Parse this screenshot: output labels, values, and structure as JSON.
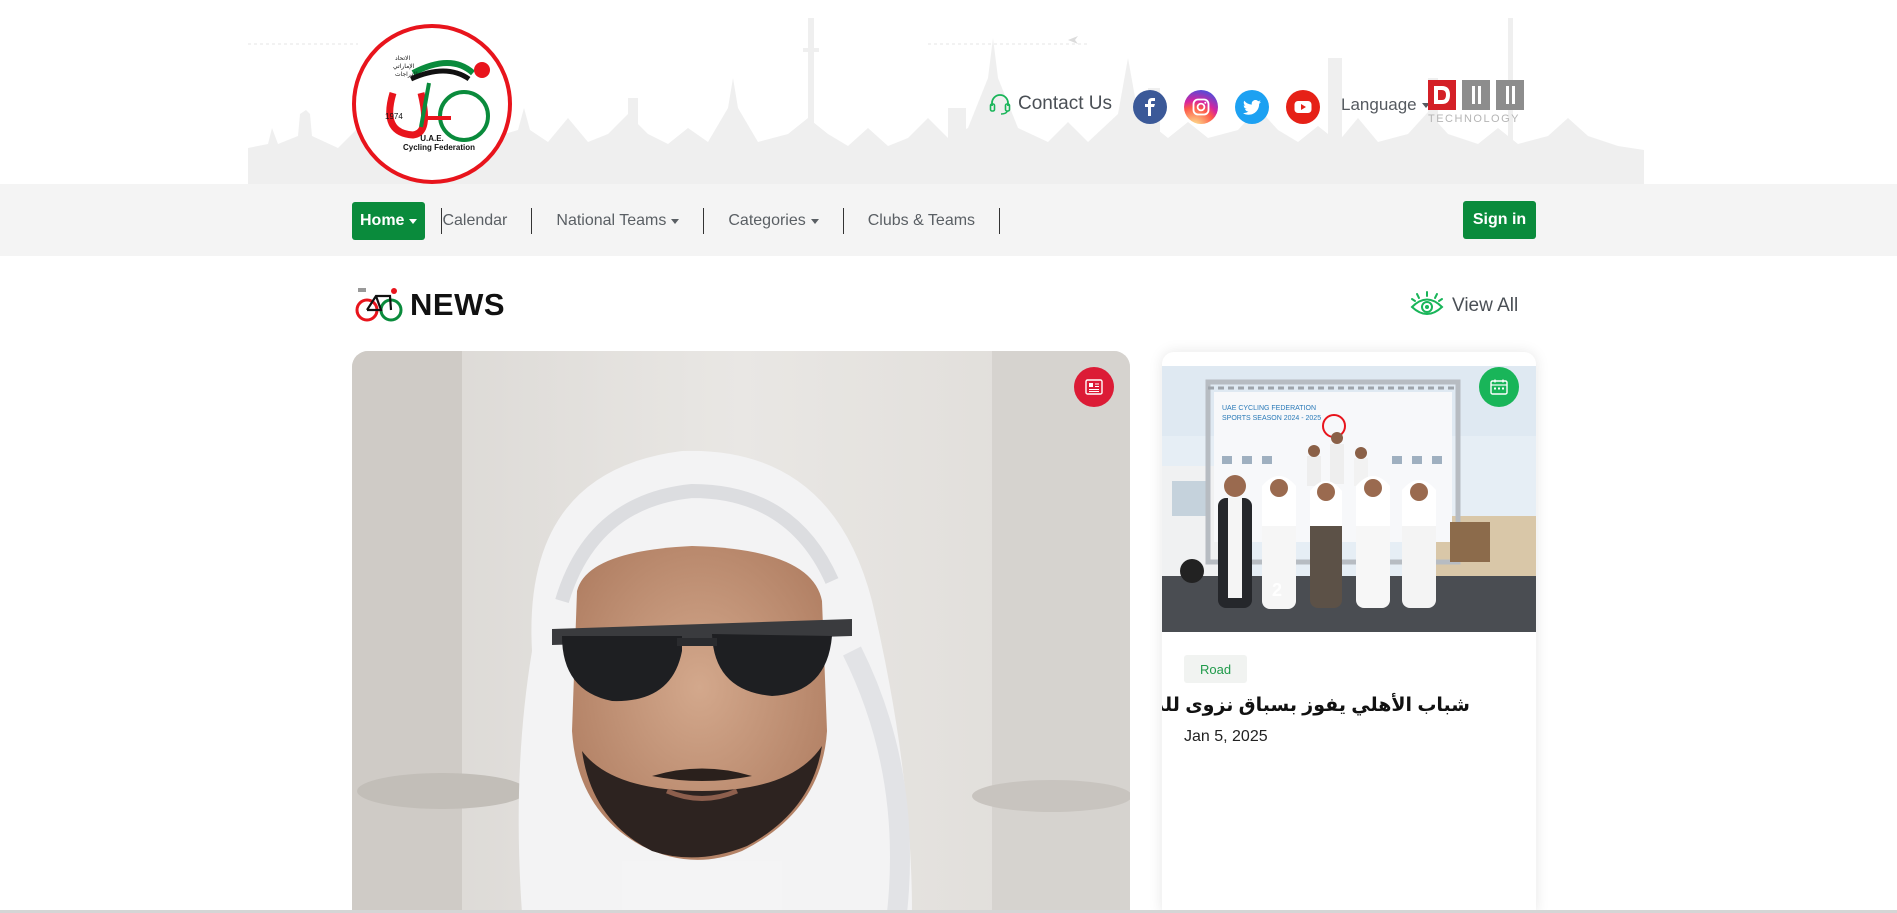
{
  "header": {
    "logo_lines": [
      "U.A.E.",
      "Cycling Federation"
    ],
    "logo_year": "1974",
    "logo_arabic": [
      "الاتحاد",
      "الإماراتي",
      "للدراجات"
    ],
    "contact_label": "Contact Us",
    "socials": [
      {
        "name": "facebook",
        "glyph": "f"
      },
      {
        "name": "instagram",
        "glyph": "◎"
      },
      {
        "name": "twitter",
        "glyph": "t"
      },
      {
        "name": "youtube",
        "glyph": "▶"
      }
    ],
    "language_label": "Language",
    "partner_logo_text": "TECHNOLOGY"
  },
  "nav": {
    "items": [
      {
        "label": "Home",
        "dropdown": true,
        "active": true
      },
      {
        "label": "Calendar",
        "dropdown": false
      },
      {
        "label": "National Teams",
        "dropdown": true
      },
      {
        "label": "Categories",
        "dropdown": true
      },
      {
        "label": "Clubs & Teams",
        "dropdown": false
      }
    ],
    "signin_label": "Sign in"
  },
  "news": {
    "title": "NEWS",
    "view_all_label": "View All",
    "side_article": {
      "tag": "Road",
      "title": "شباب الأهلي يفوز بسباق نزوى للدراجات",
      "date": "Jan 5, 2025",
      "banner_text": "UAE CYCLING FEDERATION\nSPORTS SEASON 2024 - 2025"
    }
  },
  "colors": {
    "brand_green": "#0a8b3c",
    "badge_red": "#dc1b36",
    "badge_green": "#19b559",
    "tag_text": "#1f9a4a"
  }
}
